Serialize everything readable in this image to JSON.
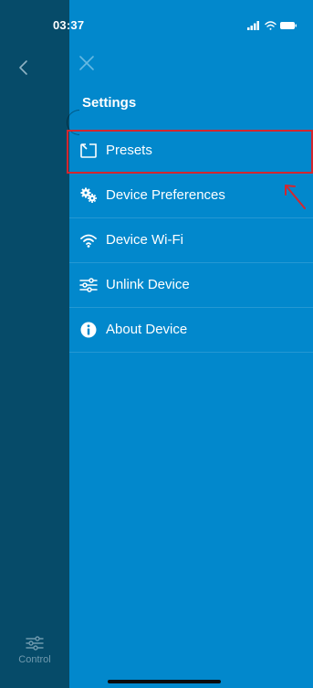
{
  "status_bar": {
    "time": "03:37"
  },
  "header": {
    "title": "Settings"
  },
  "menu": {
    "items": [
      {
        "label": "Presets",
        "icon": "presets-icon"
      },
      {
        "label": "Device Preferences",
        "icon": "gears-icon"
      },
      {
        "label": "Device Wi-Fi",
        "icon": "wifi-icon"
      },
      {
        "label": "Unlink Device",
        "icon": "sliders-icon"
      },
      {
        "label": "About Device",
        "icon": "info-icon"
      }
    ]
  },
  "bottom_nav": {
    "control_label": "Control"
  },
  "colors": {
    "panel": "#0288cc",
    "sidebar": "#064b69",
    "highlight": "#d4262e"
  }
}
